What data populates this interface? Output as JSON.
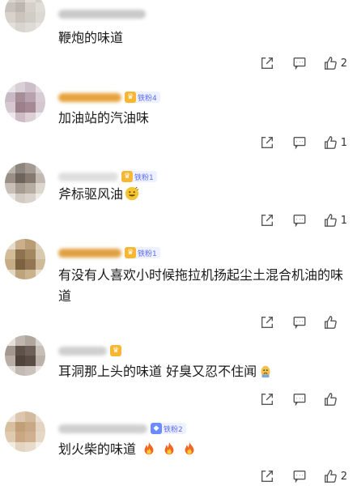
{
  "comments": [
    {
      "text": "鞭炮的味道",
      "likes": "2",
      "badge": "",
      "avatar_colors": [
        "#d9d6d0",
        "#cfc9c2",
        "#e2ddd8",
        "#d3cfc9",
        "#c9c3bd",
        "#bdb6ae",
        "#d6d0cb",
        "#e0dcd8",
        "#d7d2cc",
        "#cbc4bd",
        "#d2ccc6",
        "#dcd8d4",
        "#e3e0dc",
        "#d9d4cf",
        "#dedad6",
        "#e6e3e0"
      ]
    },
    {
      "text": "加油站的汽油味",
      "likes": "1",
      "badge": "铁粉4",
      "avatar_colors": [
        "#e8e3e7",
        "#d9cfd6",
        "#cdbfca",
        "#e4dde2",
        "#c9b9c4",
        "#a58e98",
        "#b9a2ad",
        "#d8ccd3",
        "#d6c8d0",
        "#9c8089",
        "#a68a93",
        "#d5c7ce",
        "#ece7ea",
        "#cdbcc4",
        "#dcd0d6",
        "#efeaed"
      ]
    },
    {
      "text": "斧标驱风油",
      "likes": "1",
      "badge": "铁粉1",
      "avatar_colors": [
        "#b9b3ac",
        "#8e857e",
        "#a39a92",
        "#d3cdc7",
        "#9a8f86",
        "#6f645c",
        "#857970",
        "#c2bab2",
        "#c8c0b8",
        "#a89d93",
        "#b8ada3",
        "#ddd6cf",
        "#e9e5e1",
        "#d2cbc4",
        "#dad3cd",
        "#efebe7"
      ]
    },
    {
      "text": "有没有人喜欢小时候拖拉机扬起尘土混合机油的味道",
      "likes": "",
      "badge": "铁粉1",
      "avatar_colors": [
        "#e7dccb",
        "#c9b08a",
        "#b89c74",
        "#ddcfba",
        "#d1bb98",
        "#8d7350",
        "#a2875f",
        "#d8c8ae",
        "#c6ad86",
        "#7c6241",
        "#937755",
        "#cfbb9a",
        "#e3d6c3",
        "#bda47c",
        "#c9b28c",
        "#eadfd0"
      ]
    },
    {
      "text": "耳洞那上头的味道 好臭又忍不住闻",
      "likes": "",
      "badge": "",
      "avatar_colors": [
        "#e4e0dc",
        "#bfb6af",
        "#b1a69e",
        "#d9d3ce",
        "#a39890",
        "#5f524a",
        "#6d6058",
        "#c7beb7",
        "#b9aea6",
        "#4f433c",
        "#5a4d46",
        "#bcb2aa",
        "#e0dbd6",
        "#c3bab3",
        "#cac2bb",
        "#e8e5e2"
      ]
    },
    {
      "text": "划火柴的味道",
      "likes": "2",
      "badge": "铁粉2",
      "avatar_colors": [
        "#efe5da",
        "#dcc7ae",
        "#d2ba9d",
        "#ebdfd0",
        "#d7bf9f",
        "#c19f78",
        "#c8a885",
        "#e3d3bf",
        "#dfcbb2",
        "#caa883",
        "#d0b08e",
        "#e6d8c6",
        "#f2ebe2",
        "#e4d5c3",
        "#e8dbcb",
        "#f5efe8"
      ]
    }
  ],
  "accent": "#f7b733",
  "badge_accent": "#5b6cf0"
}
